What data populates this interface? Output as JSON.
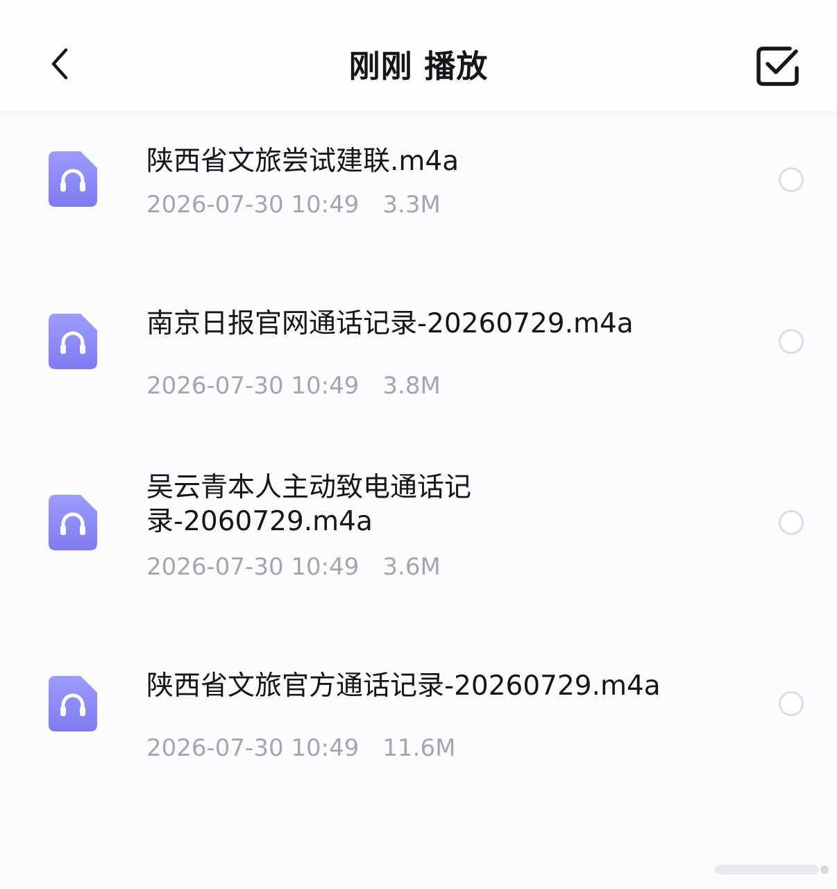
{
  "header": {
    "title": "刚刚 播放",
    "back_icon": "chevron-left-icon",
    "select_icon": "checkbox-checked-icon"
  },
  "files": [
    {
      "name": "陕西省文旅尝试建联.m4a",
      "date": "2026-07-30 10:49",
      "size": "3.3M",
      "selected": false
    },
    {
      "name": "南京日报官网通话记录-20260729.m4a",
      "date": "2026-07-30 10:49",
      "size": "3.8M",
      "selected": false
    },
    {
      "name": "吴云青本人主动致电通话记录-2060729.m4a",
      "date": "2026-07-30 10:49",
      "size": "3.6M",
      "selected": false
    },
    {
      "name": "陕西省文旅官方通话记录-20260729.m4a",
      "date": "2026-07-30 10:49",
      "size": "11.6M",
      "selected": false
    }
  ],
  "colors": {
    "icon_gradient_top": "#9b9afc",
    "icon_gradient_bottom": "#7f7cf2",
    "title_text": "#15161a",
    "meta_text": "#a2a6b4",
    "radio_border": "#dcdde2"
  }
}
